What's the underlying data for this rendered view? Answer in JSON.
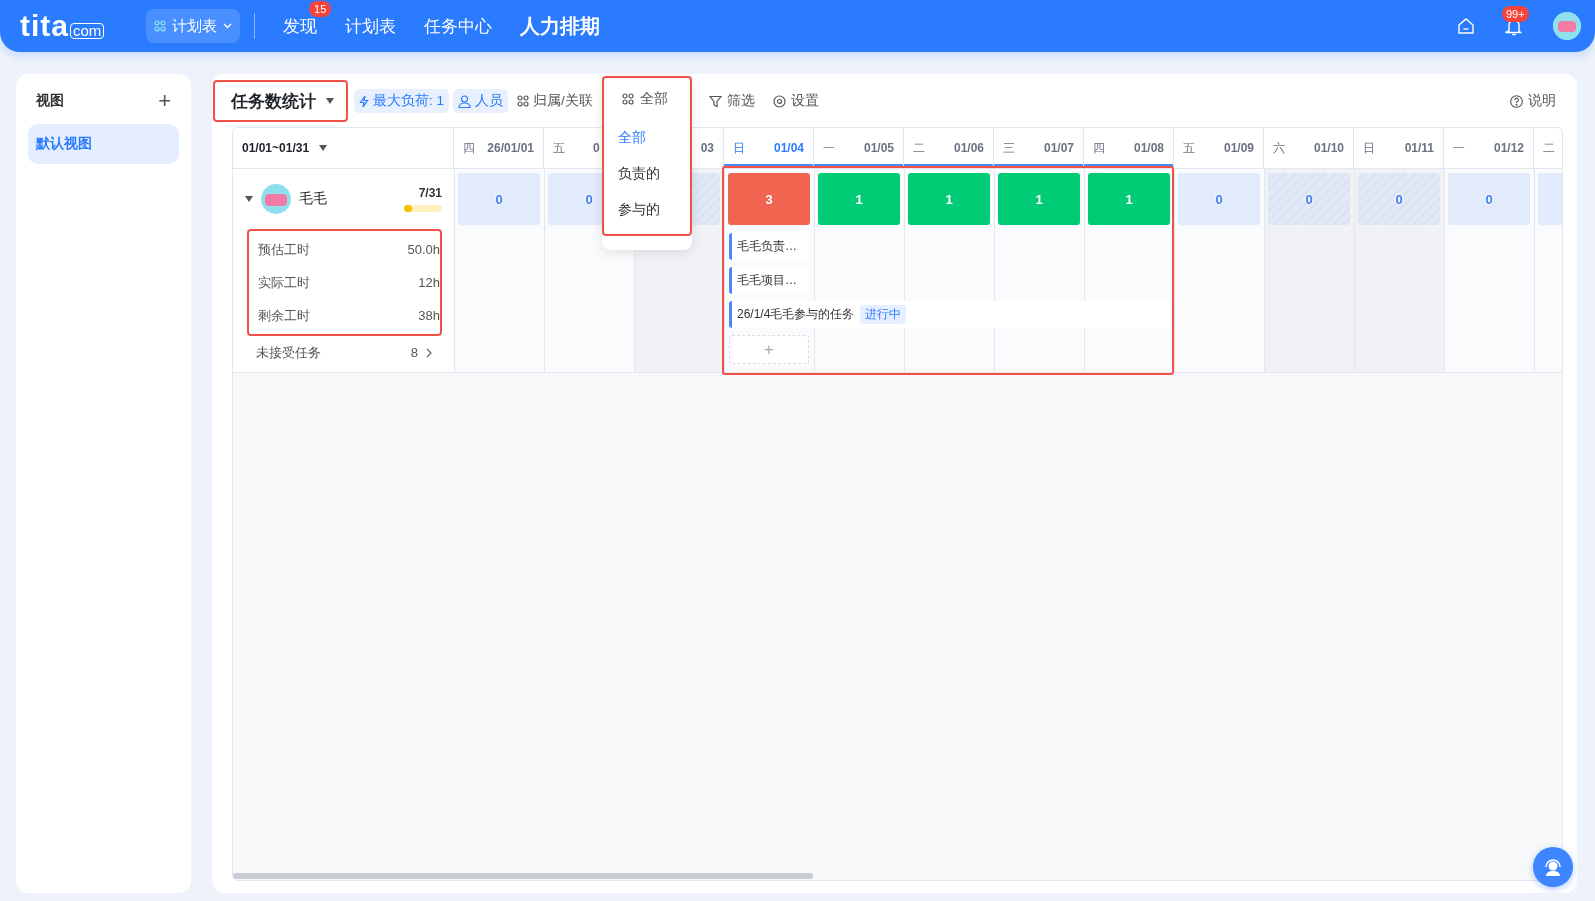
{
  "topbar": {
    "logo": {
      "name": "tita",
      "suffix": "com"
    },
    "app_switcher": {
      "label": "计划表"
    },
    "nav": [
      {
        "label": "发现",
        "badge": "15",
        "selected": false
      },
      {
        "label": "计划表",
        "selected": false
      },
      {
        "label": "任务中心",
        "selected": false
      },
      {
        "label": "人力排期",
        "selected": true
      }
    ],
    "notifications_badge": "99+"
  },
  "sidebar": {
    "title": "视图",
    "add": "+",
    "items": [
      {
        "label": "默认视图",
        "selected": true
      }
    ]
  },
  "toolbar": {
    "view": {
      "label": "任务数统计",
      "highlighted": true
    },
    "chips": [
      {
        "label": "最大负荷: 1",
        "kind": "active"
      },
      {
        "label": "人员",
        "kind": "active"
      },
      {
        "label": "归属/关联",
        "kind": "plain"
      }
    ],
    "filter": "筛选",
    "settings": "设置",
    "help": "说明"
  },
  "scope_menu": {
    "label": "全部",
    "highlighted": true,
    "options": [
      {
        "label": "全部",
        "selected": true
      },
      {
        "label": "负责的",
        "selected": false
      },
      {
        "label": "参与的",
        "selected": false
      }
    ]
  },
  "board": {
    "range": "01/01~01/31",
    "person": {
      "name": "毛毛",
      "ratio": "7/31",
      "level": 0.12,
      "expanded": true
    },
    "stats_highlighted": true,
    "stats": [
      {
        "label": "预估工时",
        "value": "50.0h"
      },
      {
        "label": "实际工时",
        "value": "12h"
      },
      {
        "label": "剩余工时",
        "value": "38h"
      }
    ],
    "unaccepted": {
      "label": "未接受任务",
      "count": "8"
    },
    "range_highlighted": true,
    "days": [
      {
        "heading": {
          "kind": "full",
          "weekday": "四",
          "date": "26/01/01"
        },
        "kind": "workday",
        "workload": {
          "kind": "none",
          "count": "0"
        },
        "in_range": false,
        "selected": false
      },
      {
        "heading": {
          "kind": "clipped",
          "weekday": "五",
          "date": "0"
        },
        "kind": "workday",
        "workload": {
          "kind": "none",
          "count": "0"
        },
        "in_range": false,
        "selected": false
      },
      {
        "heading": {
          "kind": "full",
          "date": "03"
        },
        "kind": "weekend",
        "workload": {
          "kind": "none"
        },
        "in_range": false,
        "selected": false
      },
      {
        "heading": {
          "kind": "full",
          "weekday": "日",
          "date": "01/04"
        },
        "kind": "workday",
        "workload": {
          "kind": "over",
          "count": "3"
        },
        "in_range": true,
        "selected": true,
        "tasks": [
          {
            "title": "毛毛负责…",
            "kind": "single"
          },
          {
            "title": "毛毛项目…",
            "kind": "single"
          },
          {
            "title": "26/1/4毛毛参与的任务",
            "badge": "进行中",
            "kind": "multi-day"
          }
        ],
        "add_label": "+"
      },
      {
        "heading": {
          "kind": "full",
          "weekday": "一",
          "date": "01/05"
        },
        "kind": "workday",
        "workload": {
          "kind": "normal",
          "count": "1"
        },
        "in_range": true,
        "selected": false
      },
      {
        "heading": {
          "kind": "full",
          "weekday": "二",
          "date": "01/06"
        },
        "kind": "workday",
        "workload": {
          "kind": "normal",
          "count": "1"
        },
        "in_range": true,
        "selected": false
      },
      {
        "heading": {
          "kind": "full",
          "weekday": "三",
          "date": "01/07"
        },
        "kind": "workday",
        "workload": {
          "kind": "normal",
          "count": "1"
        },
        "in_range": true,
        "selected": false
      },
      {
        "heading": {
          "kind": "full",
          "weekday": "四",
          "date": "01/08"
        },
        "kind": "workday",
        "workload": {
          "kind": "normal",
          "count": "1"
        },
        "in_range": true,
        "selected": false
      },
      {
        "heading": {
          "kind": "full",
          "weekday": "五",
          "date": "01/09"
        },
        "kind": "workday",
        "workload": {
          "kind": "none",
          "count": "0"
        },
        "in_range": false,
        "selected": false
      },
      {
        "heading": {
          "kind": "full",
          "weekday": "六",
          "date": "01/10"
        },
        "kind": "weekend",
        "workload": {
          "kind": "none",
          "count": "0"
        },
        "in_range": false,
        "selected": false
      },
      {
        "heading": {
          "kind": "full",
          "weekday": "日",
          "date": "01/11"
        },
        "kind": "weekend",
        "workload": {
          "kind": "none",
          "count": "0"
        },
        "in_range": false,
        "selected": false
      },
      {
        "heading": {
          "kind": "full",
          "weekday": "一",
          "date": "01/12"
        },
        "kind": "workday",
        "workload": {
          "kind": "none",
          "count": "0"
        },
        "in_range": false,
        "selected": false
      },
      {
        "heading": {
          "kind": "full",
          "weekday": "二"
        },
        "kind": "workday",
        "workload": {
          "kind": "none"
        },
        "in_range": false,
        "selected": false
      }
    ]
  }
}
